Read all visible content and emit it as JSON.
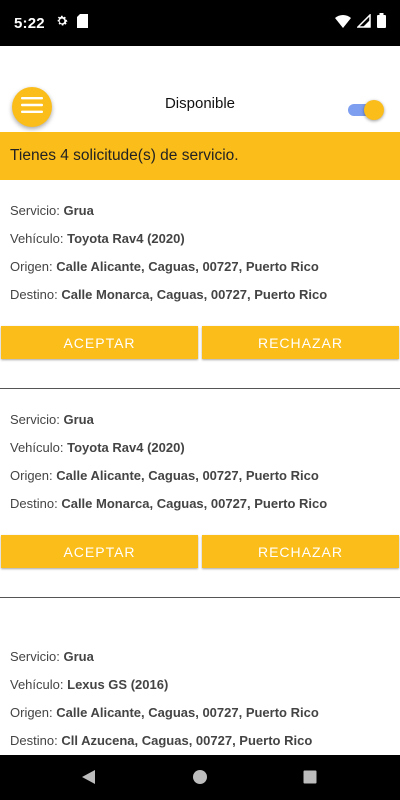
{
  "status_bar": {
    "time": "5:22",
    "icons_left": [
      "gear-icon",
      "sd-card-icon"
    ],
    "icons_right": [
      "wifi-icon",
      "signal-icon",
      "battery-icon"
    ]
  },
  "header": {
    "title": "Disponible",
    "menu_icon": "hamburger-icon",
    "availability_toggle": {
      "state": "on"
    }
  },
  "banner": {
    "text": "Tienes 4 solicitude(s) de servicio."
  },
  "labels": {
    "service": "Servicio:",
    "vehicle": "Vehículo:",
    "origin": "Origen:",
    "destination": "Destino:",
    "accept": "ACEPTAR",
    "reject": "RECHAZAR"
  },
  "requests": [
    {
      "service": "Grua",
      "vehicle": "Toyota Rav4 (2020)",
      "origin": "Calle Alicante, Caguas, 00727, Puerto Rico",
      "destination": "Calle Monarca, Caguas, 00727, Puerto Rico"
    },
    {
      "service": "Grua",
      "vehicle": "Toyota Rav4 (2020)",
      "origin": "Calle Alicante, Caguas, 00727, Puerto Rico",
      "destination": "Calle Monarca, Caguas, 00727, Puerto Rico"
    },
    {
      "service": "Grua",
      "vehicle": "Lexus GS (2016)",
      "origin": "Calle Alicante, Caguas, 00727, Puerto Rico",
      "destination": "Cll Azucena, Caguas, 00727, Puerto Rico"
    }
  ],
  "colors": {
    "accent": "#fbbd1a",
    "toggle_track": "#7e9ef0",
    "bars": "#000000"
  },
  "nav_bar": {
    "icons": [
      "back-icon",
      "home-icon",
      "recents-icon"
    ]
  }
}
